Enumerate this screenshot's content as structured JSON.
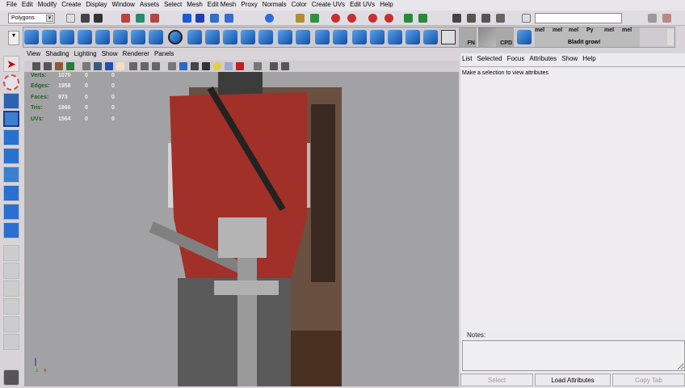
{
  "menubar": [
    "File",
    "Edit",
    "Modify",
    "Create",
    "Display",
    "Window",
    "Assets",
    "Select",
    "Mesh",
    "Edit Mesh",
    "Proxy",
    "Normals",
    "Color",
    "Create UVs",
    "Edit UVs",
    "Help"
  ],
  "status": {
    "mode": "Polygons",
    "command_value": ""
  },
  "shelf": {
    "fn_label": "FN",
    "cpd_label": "CPD",
    "mel_label": "mel",
    "py_label": "Py",
    "script_caption": "Bladit grow!"
  },
  "viewport": {
    "menu": [
      "View",
      "Shading",
      "Lighting",
      "Show",
      "Renderer",
      "Panels"
    ],
    "hud": [
      {
        "label": "Verts:",
        "values": [
          "1070",
          "0",
          "0"
        ]
      },
      {
        "label": "Edges:",
        "values": [
          "1958",
          "0",
          "0"
        ]
      },
      {
        "label": "Faces:",
        "values": [
          "973",
          "0",
          "0"
        ]
      },
      {
        "label": "Tris:",
        "values": [
          "1866",
          "0",
          "0"
        ]
      },
      {
        "label": "UVs:",
        "values": [
          "1564",
          "0",
          "0"
        ]
      }
    ],
    "axis": {
      "z": "z",
      "x": "x"
    }
  },
  "attribute_editor": {
    "menu": [
      "List",
      "Selected",
      "Focus",
      "Attributes",
      "Show",
      "Help"
    ],
    "message": "Make a selection to view attributes",
    "notes_label": "Notes:",
    "buttons": {
      "select": "Select",
      "load": "Load Attributes",
      "copy": "Copy Tab"
    }
  }
}
